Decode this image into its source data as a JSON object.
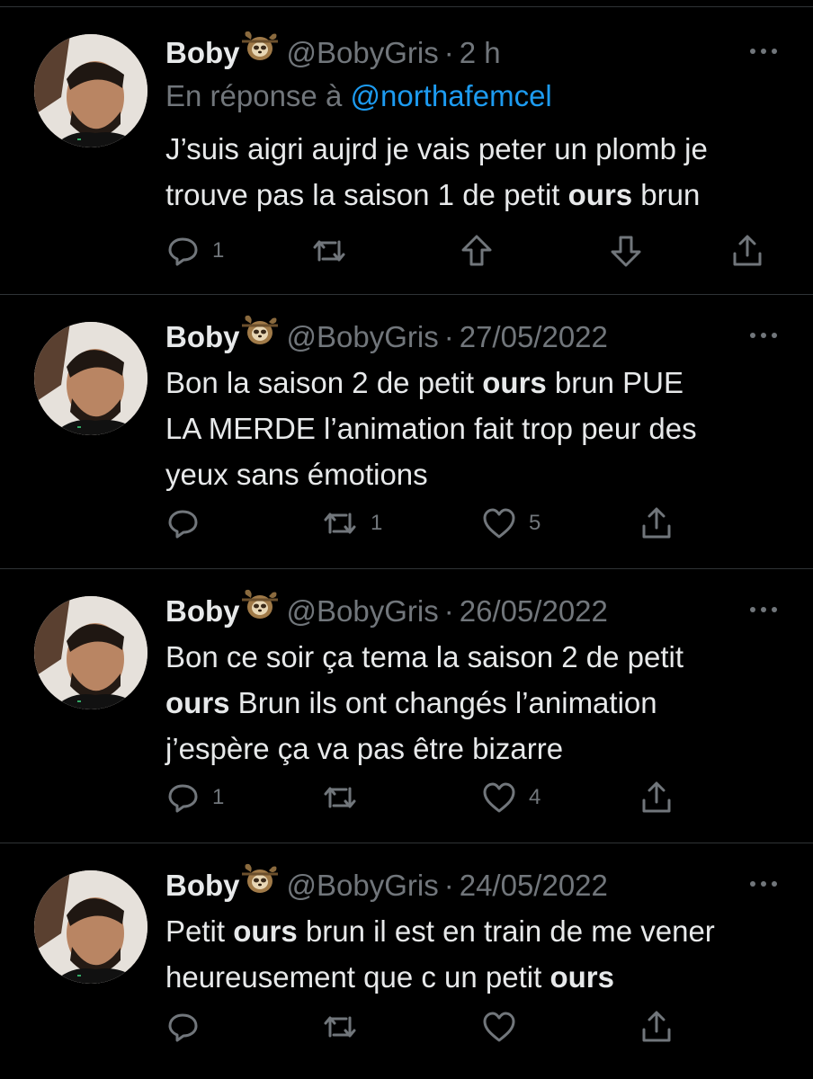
{
  "tweets": [
    {
      "name": "Boby",
      "handle": "@BobyGris",
      "separator": "·",
      "time": "2 h",
      "reply_prefix": "En réponse à",
      "reply_mention": "@northafemcel",
      "text_segments": [
        {
          "t": "J’suis aigri aujrd je vais peter un plomb je\ntrouve pas la saison 1 de petit ",
          "bold": false
        },
        {
          "t": "ours",
          "bold": true
        },
        {
          "t": " brun",
          "bold": false
        }
      ],
      "actions": {
        "reply_count": "1",
        "retweet_count": "",
        "upvote": "upvote-icon",
        "downvote": "downvote-icon",
        "share": "share-icon"
      }
    },
    {
      "name": "Boby",
      "handle": "@BobyGris",
      "separator": "·",
      "time": "27/05/2022",
      "text_segments": [
        {
          "t": "Bon la saison 2 de petit ",
          "bold": false
        },
        {
          "t": "ours",
          "bold": true
        },
        {
          "t": " brun PUE\nLA MERDE l’animation fait trop peur des\nyeux sans émotions",
          "bold": false
        }
      ],
      "actions": {
        "reply_count": "",
        "retweet_count": "1",
        "like_count": "5"
      }
    },
    {
      "name": "Boby",
      "handle": "@BobyGris",
      "separator": "·",
      "time": "26/05/2022",
      "text_segments": [
        {
          "t": "Bon ce soir ça tema la saison 2 de petit\n",
          "bold": false
        },
        {
          "t": "ours",
          "bold": true
        },
        {
          "t": " Brun ils ont changés l’animation\nj’espère ça va pas être bizarre",
          "bold": false
        }
      ],
      "actions": {
        "reply_count": "1",
        "retweet_count": "",
        "like_count": "4"
      }
    },
    {
      "name": "Boby",
      "handle": "@BobyGris",
      "separator": "·",
      "time": "24/05/2022",
      "text_segments": [
        {
          "t": "Petit ",
          "bold": false
        },
        {
          "t": "ours",
          "bold": true
        },
        {
          "t": " brun il est en train de me vener\nheureusement que c un petit ",
          "bold": false
        },
        {
          "t": "ours",
          "bold": true
        }
      ],
      "actions": {
        "reply_count": "",
        "retweet_count": "",
        "like_count": ""
      }
    }
  ],
  "colors": {
    "background": "#000000",
    "text": "#e7e9ea",
    "muted": "#71767b",
    "mention": "#1d9bf0",
    "divider": "#2f3336"
  },
  "icons": {
    "avatar": "profile-photo",
    "emoji": "sloth-emoji",
    "more": "more-dots-icon",
    "reply": "reply-icon",
    "retweet": "retweet-icon",
    "like": "heart-icon",
    "share": "share-icon"
  }
}
